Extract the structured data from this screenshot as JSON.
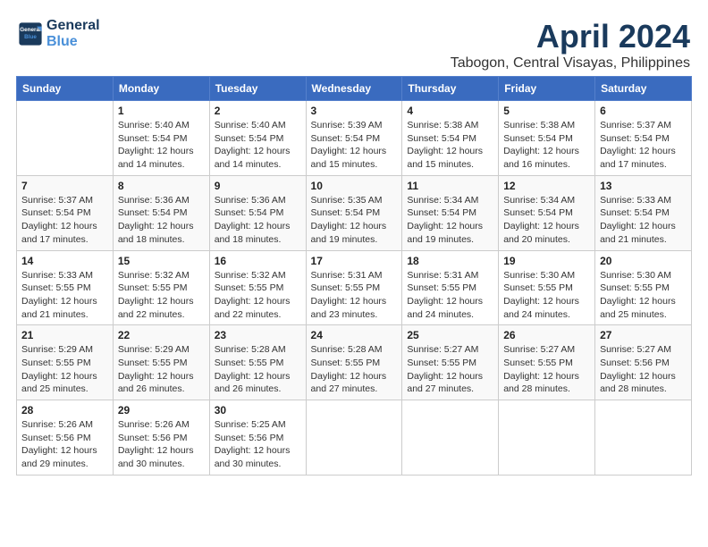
{
  "logo": {
    "line1": "General",
    "line2": "Blue"
  },
  "title": "April 2024",
  "location": "Tabogon, Central Visayas, Philippines",
  "weekdays": [
    "Sunday",
    "Monday",
    "Tuesday",
    "Wednesday",
    "Thursday",
    "Friday",
    "Saturday"
  ],
  "weeks": [
    [
      null,
      {
        "day": "1",
        "sunrise": "5:40 AM",
        "sunset": "5:54 PM",
        "daylight": "12 hours and 14 minutes."
      },
      {
        "day": "2",
        "sunrise": "5:40 AM",
        "sunset": "5:54 PM",
        "daylight": "12 hours and 14 minutes."
      },
      {
        "day": "3",
        "sunrise": "5:39 AM",
        "sunset": "5:54 PM",
        "daylight": "12 hours and 15 minutes."
      },
      {
        "day": "4",
        "sunrise": "5:38 AM",
        "sunset": "5:54 PM",
        "daylight": "12 hours and 15 minutes."
      },
      {
        "day": "5",
        "sunrise": "5:38 AM",
        "sunset": "5:54 PM",
        "daylight": "12 hours and 16 minutes."
      },
      {
        "day": "6",
        "sunrise": "5:37 AM",
        "sunset": "5:54 PM",
        "daylight": "12 hours and 17 minutes."
      }
    ],
    [
      {
        "day": "7",
        "sunrise": "5:37 AM",
        "sunset": "5:54 PM",
        "daylight": "12 hours and 17 minutes."
      },
      {
        "day": "8",
        "sunrise": "5:36 AM",
        "sunset": "5:54 PM",
        "daylight": "12 hours and 18 minutes."
      },
      {
        "day": "9",
        "sunrise": "5:36 AM",
        "sunset": "5:54 PM",
        "daylight": "12 hours and 18 minutes."
      },
      {
        "day": "10",
        "sunrise": "5:35 AM",
        "sunset": "5:54 PM",
        "daylight": "12 hours and 19 minutes."
      },
      {
        "day": "11",
        "sunrise": "5:34 AM",
        "sunset": "5:54 PM",
        "daylight": "12 hours and 19 minutes."
      },
      {
        "day": "12",
        "sunrise": "5:34 AM",
        "sunset": "5:54 PM",
        "daylight": "12 hours and 20 minutes."
      },
      {
        "day": "13",
        "sunrise": "5:33 AM",
        "sunset": "5:54 PM",
        "daylight": "12 hours and 21 minutes."
      }
    ],
    [
      {
        "day": "14",
        "sunrise": "5:33 AM",
        "sunset": "5:55 PM",
        "daylight": "12 hours and 21 minutes."
      },
      {
        "day": "15",
        "sunrise": "5:32 AM",
        "sunset": "5:55 PM",
        "daylight": "12 hours and 22 minutes."
      },
      {
        "day": "16",
        "sunrise": "5:32 AM",
        "sunset": "5:55 PM",
        "daylight": "12 hours and 22 minutes."
      },
      {
        "day": "17",
        "sunrise": "5:31 AM",
        "sunset": "5:55 PM",
        "daylight": "12 hours and 23 minutes."
      },
      {
        "day": "18",
        "sunrise": "5:31 AM",
        "sunset": "5:55 PM",
        "daylight": "12 hours and 24 minutes."
      },
      {
        "day": "19",
        "sunrise": "5:30 AM",
        "sunset": "5:55 PM",
        "daylight": "12 hours and 24 minutes."
      },
      {
        "day": "20",
        "sunrise": "5:30 AM",
        "sunset": "5:55 PM",
        "daylight": "12 hours and 25 minutes."
      }
    ],
    [
      {
        "day": "21",
        "sunrise": "5:29 AM",
        "sunset": "5:55 PM",
        "daylight": "12 hours and 25 minutes."
      },
      {
        "day": "22",
        "sunrise": "5:29 AM",
        "sunset": "5:55 PM",
        "daylight": "12 hours and 26 minutes."
      },
      {
        "day": "23",
        "sunrise": "5:28 AM",
        "sunset": "5:55 PM",
        "daylight": "12 hours and 26 minutes."
      },
      {
        "day": "24",
        "sunrise": "5:28 AM",
        "sunset": "5:55 PM",
        "daylight": "12 hours and 27 minutes."
      },
      {
        "day": "25",
        "sunrise": "5:27 AM",
        "sunset": "5:55 PM",
        "daylight": "12 hours and 27 minutes."
      },
      {
        "day": "26",
        "sunrise": "5:27 AM",
        "sunset": "5:55 PM",
        "daylight": "12 hours and 28 minutes."
      },
      {
        "day": "27",
        "sunrise": "5:27 AM",
        "sunset": "5:56 PM",
        "daylight": "12 hours and 28 minutes."
      }
    ],
    [
      {
        "day": "28",
        "sunrise": "5:26 AM",
        "sunset": "5:56 PM",
        "daylight": "12 hours and 29 minutes."
      },
      {
        "day": "29",
        "sunrise": "5:26 AM",
        "sunset": "5:56 PM",
        "daylight": "12 hours and 30 minutes."
      },
      {
        "day": "30",
        "sunrise": "5:25 AM",
        "sunset": "5:56 PM",
        "daylight": "12 hours and 30 minutes."
      },
      null,
      null,
      null,
      null
    ]
  ],
  "labels": {
    "sunrise": "Sunrise:",
    "sunset": "Sunset:",
    "daylight": "Daylight:"
  }
}
